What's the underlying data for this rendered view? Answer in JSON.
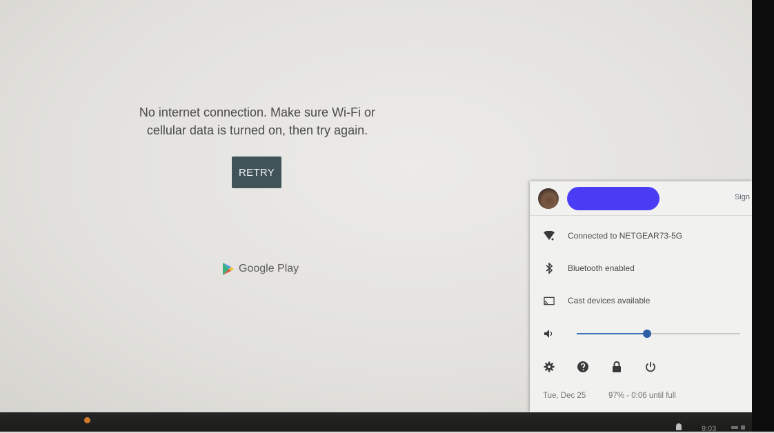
{
  "main": {
    "message": "No internet connection. Make sure Wi-Fi or cellular data is turned on, then try again.",
    "retry_label": "RETRY",
    "store_name": "Google Play"
  },
  "tray": {
    "sign_out_label": "Sign",
    "wifi_label": "Connected to NETGEAR73-5G",
    "bluetooth_label": "Bluetooth enabled",
    "cast_label": "Cast devices available",
    "volume_level": 0.43,
    "date": "Tue, Dec 25",
    "battery": "97% - 0:06 until full",
    "icons": [
      "wifi-icon",
      "bluetooth-icon",
      "cast-icon",
      "volume-icon",
      "settings-icon",
      "help-icon",
      "lock-icon",
      "power-icon"
    ]
  },
  "shelf": {
    "time": "9:03"
  },
  "colors": {
    "retry_bg": "#3f5358",
    "accent": "#2c5fa3",
    "redaction": "#4a3cf5"
  }
}
